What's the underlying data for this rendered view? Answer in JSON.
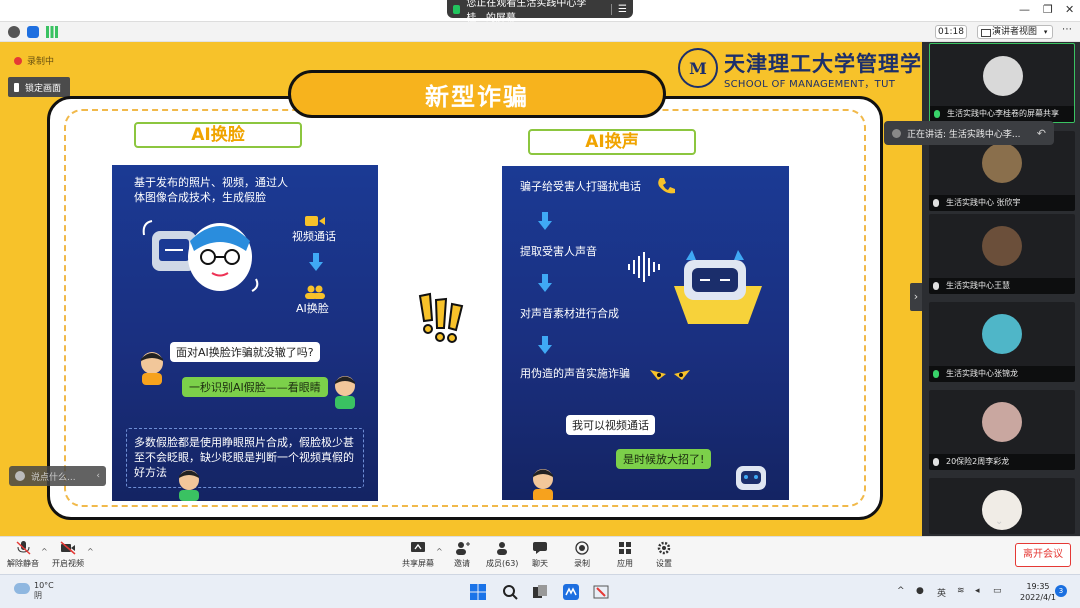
{
  "window": {
    "share_notice": "您正在观看生活实践中心李桂...的屏幕"
  },
  "meeting": {
    "timer": "01:18",
    "view_mode": "演讲者视图",
    "recording_label": "录制中",
    "lock_label": "锁定画面",
    "speaking_now": "正在讲话: 生活实践中心李...",
    "chat_placeholder": "说点什么..."
  },
  "slide": {
    "logo_cn": "天津理工大学管理学院",
    "logo_en": "SCHOOL OF MANAGEMENT，TUT",
    "logo_mark": "M",
    "title": "新型诈骗",
    "left": {
      "label": "AI换脸",
      "intro": "基于发布的照片、视频，通过人体图像合成技术，生成假脸",
      "step1": "视频通话",
      "step2": "AI换脸",
      "question": "面对AI换脸诈骗就没辙了吗?",
      "answer": "一秒识别AI假脸——看眼睛",
      "note": "多数假脸都是使用睁眼照片合成，假脸极少甚至不会眨眼，缺少眨眼是判断一个视频真假的好方法"
    },
    "right": {
      "label": "AI换声",
      "step1": "骗子给受害人打骚扰电话",
      "step2": "提取受害人声音",
      "step3": "对声音素材进行合成",
      "step4": "用伪造的声音实施诈骗",
      "bubble1": "我可以视频通话",
      "bubble2": "是时候放大招了!"
    }
  },
  "participants": [
    {
      "name": "生活实践中心李桂卷的屏幕共享",
      "mic": "live",
      "avatar_color": "#d9d9d9"
    },
    {
      "name": "生活实践中心 张欣宇",
      "mic": "muted",
      "avatar_color": "#8a6f4c"
    },
    {
      "name": "生活实践中心王慧",
      "mic": "muted",
      "avatar_color": "#6b4f3a"
    },
    {
      "name": "生活实践中心张锦龙",
      "mic": "live",
      "avatar_color": "#4fb6c8"
    },
    {
      "name": "20保险2周李彩龙",
      "mic": "muted",
      "avatar_color": "#c9a7a0"
    },
    {
      "name": "",
      "mic": "none",
      "avatar_color": "#f0ece6"
    }
  ],
  "toolbar": {
    "mute": "解除静音",
    "video": "开启视频",
    "share": "共享屏幕",
    "invite": "邀请",
    "members": "成员(63)",
    "chat": "聊天",
    "record": "录制",
    "apps": "应用",
    "settings": "设置",
    "leave": "离开会议"
  },
  "taskbar": {
    "temp": "10°C",
    "weather": "阴",
    "ime": "英",
    "time": "19:35",
    "date": "2022/4/1",
    "notifications": "3"
  },
  "colors": {
    "stage_yellow": "#f7c22a",
    "panel_blue": "#1b3a94",
    "label_green": "#8cc63f",
    "leave_red": "#e53935"
  }
}
